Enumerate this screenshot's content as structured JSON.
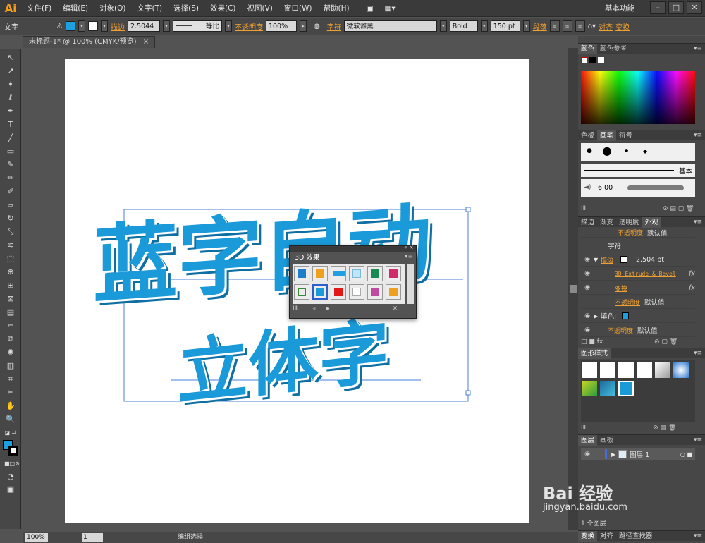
{
  "app": {
    "logo": "Ai",
    "workspace": "基本功能"
  },
  "menus": [
    "文件(F)",
    "编辑(E)",
    "对象(O)",
    "文字(T)",
    "选择(S)",
    "效果(C)",
    "视图(V)",
    "窗口(W)",
    "帮助(H)"
  ],
  "controlbar": {
    "type_label": "文字",
    "stroke_label": "描边",
    "stroke_value": "2.5044",
    "profile_label": "等比",
    "opacity_label": "不透明度",
    "opacity_value": "100%",
    "char_label": "字符",
    "font_family": "微软雅黑",
    "font_style": "Bold",
    "font_size": "150 pt",
    "paragraph_label": "段落",
    "align_label": "对齐",
    "transform_label": "变换",
    "fill_color": "#1da0e0",
    "stroke_color": "#ffffff"
  },
  "document": {
    "tab_title": "未标题-1* @ 100% (CMYK/预览)"
  },
  "artwork": {
    "line1": "蓝字自动",
    "line2": "立体字",
    "color": "#1a9ad8"
  },
  "panel3d": {
    "title": "3D 效果"
  },
  "color_panel": {
    "tabs": [
      "颜色",
      "颜色参考"
    ]
  },
  "brush_panel": {
    "tabs": [
      "色板",
      "画笔",
      "符号"
    ],
    "basic_label": "基本",
    "size_value": "6.00"
  },
  "appearance_panel": {
    "tabs": [
      "描边",
      "渐变",
      "透明度",
      "外观"
    ],
    "rows": {
      "opacity_top": "不透明度",
      "opacity_top_val": "默认值",
      "char": "字符",
      "stroke": "描边",
      "stroke_val": "2.504 pt",
      "extrude": "3D Extrude & Bevel",
      "transform": "变换",
      "opacity_mid": "不透明度",
      "opacity_mid_val": "默认值",
      "fill": "填色:",
      "opacity_bot": "不透明度",
      "opacity_bot_val": "默认值"
    }
  },
  "graphic_styles": {
    "tabs": [
      "图形样式"
    ]
  },
  "layers_panel": {
    "tabs": [
      "图层",
      "画板"
    ],
    "layer_name": "图层 1",
    "footer": "1 个图层"
  },
  "bottom_tabs": [
    "变换",
    "对齐",
    "路径查找器"
  ],
  "statusbar": {
    "zoom": "100%",
    "page": "1",
    "tool": "编组选择"
  },
  "watermark": {
    "brand": "Bai 经验",
    "url": "jingyan.baidu.com"
  }
}
